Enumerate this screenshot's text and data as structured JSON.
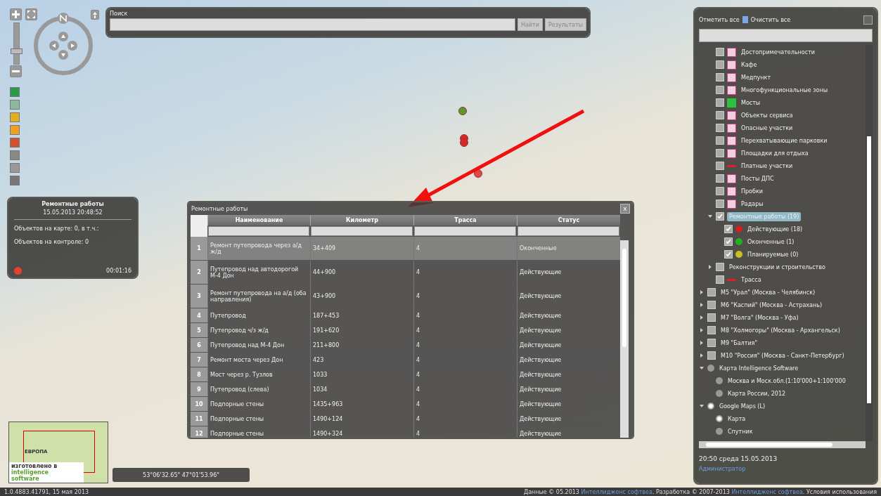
{
  "search": {
    "label": "Поиск",
    "buttons": [
      "Найти",
      "Результаты"
    ]
  },
  "zoom": {
    "level": 0.3
  },
  "map_markers": [
    {
      "color": "#5a9a2a"
    },
    {
      "color": "#d42a2a"
    },
    {
      "color": "#d42a2a"
    },
    {
      "color": "#e04848"
    }
  ],
  "info_panel": {
    "title": "Ремонтные работы",
    "datetime": "15.05.2013 20:48:52",
    "lines": [
      "Объектов на карте: 0, в т.ч.:",
      "Объектов на контроле: 0"
    ],
    "recording": true,
    "timer": "00:01:16"
  },
  "table_window": {
    "title": "Ремонтные работы",
    "close": "x",
    "columns": [
      "Наименование",
      "Километр",
      "Трасса",
      "Статус"
    ],
    "rows": [
      {
        "n": "1",
        "name": "Ремонт путепровода через а/д ж/д",
        "km": "34+409",
        "route": "4",
        "status": "Оконченные",
        "selected": true
      },
      {
        "n": "2",
        "name": "Путепровод над автодорогой М-4 Дон",
        "km": "44+900",
        "route": "4",
        "status": "Действующие",
        "selected": false
      },
      {
        "n": "3",
        "name": "Ремонт путепровода на а/д (оба направления)",
        "km": "43+900",
        "route": "4",
        "status": "Действующие",
        "selected": false
      },
      {
        "n": "4",
        "name": "Путепровод",
        "km": "187+453",
        "route": "4",
        "status": "Действующие",
        "selected": false
      },
      {
        "n": "5",
        "name": "Путепровод ч/з ж/д",
        "km": "191+620",
        "route": "4",
        "status": "Действующие",
        "selected": false
      },
      {
        "n": "6",
        "name": "Путепровод над М-4 Дон",
        "km": "211+800",
        "route": "4",
        "status": "Действующие",
        "selected": false
      },
      {
        "n": "7",
        "name": "Ремонт моста через Дон",
        "km": "423",
        "route": "4",
        "status": "Действующие",
        "selected": false
      },
      {
        "n": "8",
        "name": "Мост через р. Тузлов",
        "km": "1033",
        "route": "4",
        "status": "Действующие",
        "selected": false
      },
      {
        "n": "9",
        "name": "Путепровод (слева)",
        "km": "1034",
        "route": "4",
        "status": "Действующие",
        "selected": false
      },
      {
        "n": "10",
        "name": "Подпорные стены",
        "km": "1435+963",
        "route": "4",
        "status": "Действующие",
        "selected": false
      },
      {
        "n": "11",
        "name": "Подпорные стены",
        "km": "1490+124",
        "route": "4",
        "status": "Действующие",
        "selected": false
      },
      {
        "n": "12",
        "name": "Подпорные стены",
        "km": "1490+324",
        "route": "4",
        "status": "Действующие",
        "selected": false
      }
    ]
  },
  "layers_panel": {
    "check_all": "Отметить все",
    "clear_all": "Очистить все",
    "nested_items": [
      {
        "label": "Достопримечательности",
        "kind": "poi",
        "checked": false,
        "selected": false
      },
      {
        "label": "Кафе",
        "kind": "poi",
        "checked": false,
        "selected": false
      },
      {
        "label": "Медпункт",
        "kind": "poi",
        "checked": false,
        "selected": false
      },
      {
        "label": "Многофункциональные зоны",
        "kind": "poi",
        "checked": false,
        "selected": false
      },
      {
        "label": "Мосты",
        "kind": "bridge",
        "checked": false,
        "selected": false
      },
      {
        "label": "Объекты сервиса",
        "kind": "poi",
        "checked": false,
        "selected": false
      },
      {
        "label": "Опасные участки",
        "kind": "poi",
        "checked": false,
        "selected": false
      },
      {
        "label": "Перехватывающие парковки",
        "kind": "poi",
        "checked": false,
        "selected": false
      },
      {
        "label": "Площадки для отдыха",
        "kind": "poi",
        "checked": false,
        "selected": false
      },
      {
        "label": "Платные участки",
        "kind": "line",
        "checked": false,
        "selected": false
      },
      {
        "label": "Посты ДПС",
        "kind": "poi",
        "checked": false,
        "selected": false
      },
      {
        "label": "Пробки",
        "kind": "poi",
        "checked": false,
        "selected": false
      },
      {
        "label": "Радары",
        "kind": "poi",
        "checked": false,
        "selected": false
      },
      {
        "label": "Ремонтные работы (19)",
        "kind": "checkbox",
        "checked": true,
        "selected": true,
        "expanded": true,
        "children": [
          {
            "label": "Действующие (18)",
            "kind": "dot",
            "checked": true,
            "selected": false,
            "color": "#d02020"
          },
          {
            "label": "Оконченные (1)",
            "kind": "dot",
            "checked": true,
            "selected": false,
            "color": "#20b020"
          },
          {
            "label": "Планируемые (0)",
            "kind": "dot",
            "checked": true,
            "selected": false,
            "color": "#c8c020"
          }
        ]
      },
      {
        "label": "Реконструкции и строительство",
        "kind": "checkbox",
        "checked": false,
        "selected": false,
        "expanded": false
      },
      {
        "label": "Трасса",
        "kind": "line",
        "checked": false,
        "selected": false
      }
    ],
    "items": [
      {
        "label": "М5 \"Урал\" (Москва - Челябинск)",
        "kind": "checkbox",
        "checked": false,
        "selected": false,
        "expanded": false
      },
      {
        "label": "М6 \"Каспий\" (Москва - Астрахань)",
        "kind": "checkbox",
        "checked": false,
        "selected": false,
        "expanded": false
      },
      {
        "label": "М7 \"Волга\" (Москва - Уфа)",
        "kind": "checkbox",
        "checked": false,
        "selected": false,
        "expanded": false
      },
      {
        "label": "М8 \"Холмогоры\" (Москва - Архангельск)",
        "kind": "checkbox",
        "checked": false,
        "selected": false,
        "expanded": false
      },
      {
        "label": "М9 \"Балтия\"",
        "kind": "checkbox",
        "checked": false,
        "selected": false,
        "expanded": false
      },
      {
        "label": "М10 \"Россия\" (Москва - Санкт-Петербург)",
        "kind": "checkbox",
        "checked": false,
        "selected": false,
        "expanded": false
      },
      {
        "label": "Карта Intelligence Software",
        "kind": "radio",
        "checked": false,
        "selected": false,
        "expanded": true,
        "children": [
          {
            "label": "Москва и Моск.обл.(1:10'000+1:100'000",
            "kind": "radio",
            "checked": false,
            "selected": false
          },
          {
            "label": "Карта России, 2012",
            "kind": "radio",
            "checked": false,
            "selected": false
          }
        ]
      },
      {
        "label": "Google Maps (L)",
        "kind": "radio",
        "checked": true,
        "selected": false,
        "expanded": true,
        "children": [
          {
            "label": "Карта",
            "kind": "radio",
            "checked": true,
            "selected": false
          },
          {
            "label": "Спутник",
            "kind": "radio",
            "checked": false,
            "selected": false
          }
        ]
      }
    ],
    "clock": "20:50 среда 15.05.2013",
    "user": "Администратор"
  },
  "minimap": {
    "label": "ЕВРОПА",
    "logo": [
      "изготовлено в",
      "intelligence",
      "software"
    ]
  },
  "coordinates": "53°06'32.65\" 47°01'53.96\"",
  "footer": {
    "version": "1.0.4883.41791, 15 мая 2013",
    "parts": [
      {
        "kind": "text",
        "text": "Данные © 05.2013"
      },
      {
        "kind": "link",
        "text": "Интеллидженс софтвеа"
      },
      {
        "kind": "text",
        "text": ". Разработка © 2007-2013"
      },
      {
        "kind": "link",
        "text": "Интеллидженс софтвеа"
      },
      {
        "kind": "text",
        "text": ". Условия использования"
      }
    ]
  }
}
